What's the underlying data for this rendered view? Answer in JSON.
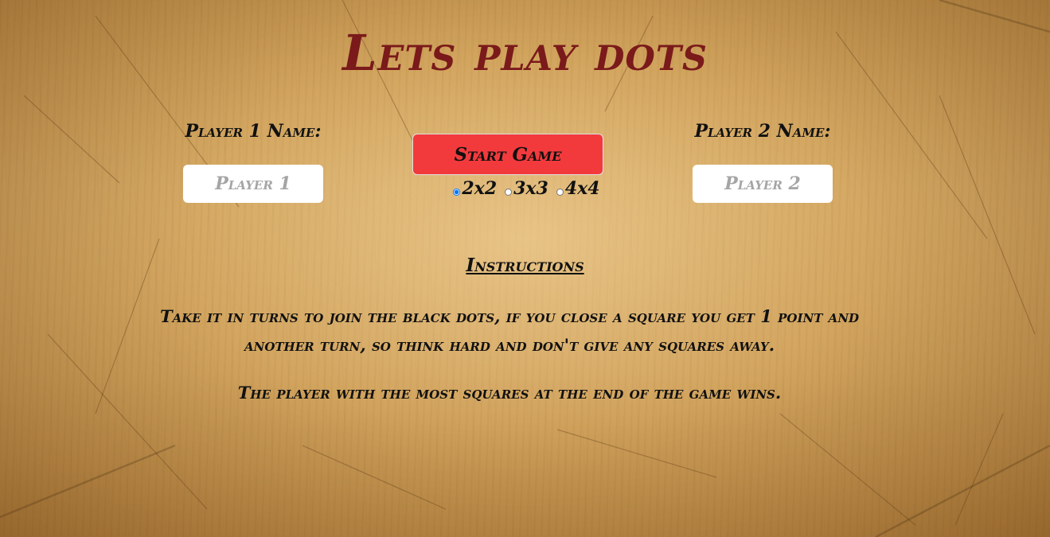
{
  "page": {
    "title": "Lets play dots"
  },
  "player1": {
    "label": "Player 1 Name:",
    "placeholder": "Player 1",
    "value": ""
  },
  "player2": {
    "label": "Player 2 Name:",
    "placeholder": "Player 2",
    "value": ""
  },
  "start_button": {
    "label": "Start Game",
    "color": "#f23a3d"
  },
  "grid_sizes": {
    "options": [
      "2x2",
      "3x3",
      "4x4"
    ],
    "selected": "2x2"
  },
  "instructions": {
    "heading": "Instructions",
    "paragraph1": "Take it in turns to join the black dots, if you close a square you get 1 point and another turn, so think hard and don't give any squares away.",
    "paragraph2": "The player with the most squares at the end of the game wins."
  },
  "colors": {
    "title": "#7a1a1a",
    "text": "#111111",
    "background": "wood-texture"
  }
}
